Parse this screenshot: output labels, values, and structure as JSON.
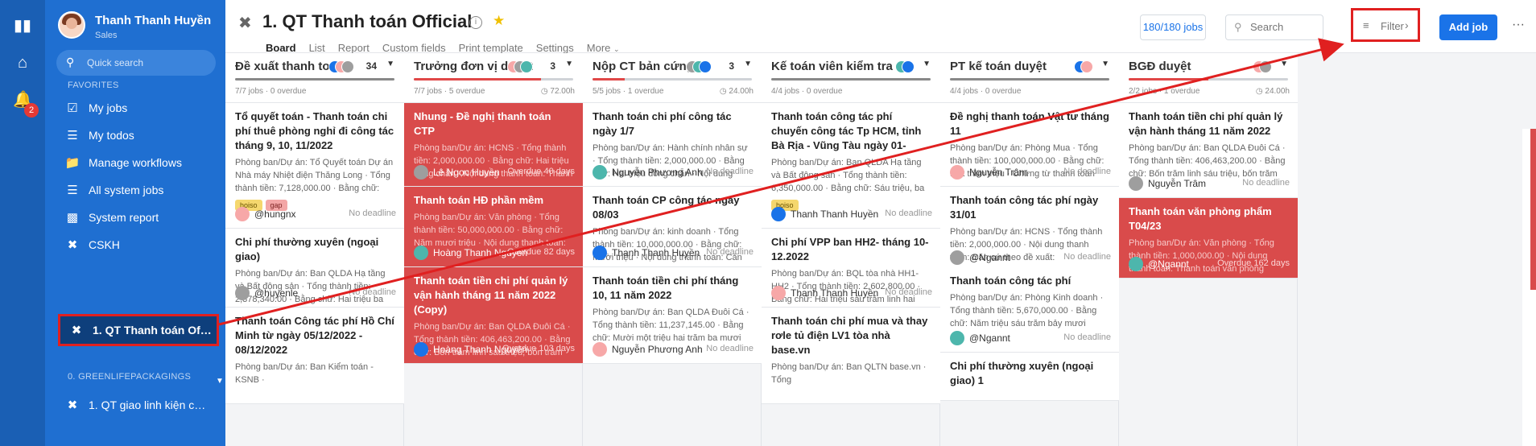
{
  "rail": {
    "notification_count": "2"
  },
  "sidebar": {
    "user_name": "Thanh Thanh Huyền",
    "user_role": "Sales",
    "quick_search_placeholder": "Quick search",
    "favorites_label": "FAVORITES",
    "items": [
      {
        "label": "My jobs",
        "icon": "check-square-icon"
      },
      {
        "label": "My todos",
        "icon": "checklist-icon"
      },
      {
        "label": "Manage workflows",
        "icon": "folder-icon"
      },
      {
        "label": "All system jobs",
        "icon": "layers-icon"
      },
      {
        "label": "System report",
        "icon": "bar-chart-icon"
      },
      {
        "label": "CSKH",
        "icon": "workflow-icon"
      },
      {
        "label": "1. QT Thanh toán Offic...",
        "icon": "workflow-icon"
      }
    ],
    "group_label": "0. GREENLIFEPACKAGINGS",
    "group_items": [
      {
        "label": "1. QT giao linh kiện ch...",
        "icon": "workflow-icon"
      }
    ]
  },
  "header": {
    "title": "1. QT Thanh toán Official",
    "tabs": [
      "Board",
      "List",
      "Report",
      "Custom fields",
      "Print template",
      "Settings",
      "More"
    ],
    "jobs_count": "180/180 jobs",
    "search_placeholder": "Search",
    "filter_label": "Filter",
    "add_job_label": "Add job",
    "more_label": "···"
  },
  "columns": [
    {
      "title": "Đề xuất thanh toán",
      "count": "34",
      "stats": "7/7 jobs · 0 overdue",
      "time": "",
      "cards": [
        {
          "title": "Tổ quyết toán - Thanh toán chi phí thuê phòng nghỉ đi công tác tháng 9, 10, 11/2022",
          "desc": "Phòng ban/Dự án: Tổ Quyết toán Dự án Nhà máy Nhiệt điện Thăng Long · Tổng thành tiền: 7,128,000.00 · Bằng chữ: Bảy triệu một...",
          "tags": [
            "hoiso",
            "gap"
          ],
          "user": "@hungnx",
          "deadline": "No deadline"
        },
        {
          "title": "Chi phí thường xuyên (ngoại giao)",
          "desc": "Phòng ban/Dự án: Ban QLDA Hạ tầng và Bất động sản · Tổng thành tiền: 2,378,340.00 · Bằng chữ: Hai triệu ba trăm bảy mươi tám...",
          "tags": [],
          "user": "@huyenle",
          "deadline": "No deadline"
        },
        {
          "title": "Thanh toán Công tác phí Hồ Chí Minh từ ngày 05/12/2022 - 08/12/2022",
          "desc": "Phòng ban/Dự án: Ban Kiểm toán - KSNB ·",
          "tags": [],
          "user": "",
          "deadline": ""
        }
      ]
    },
    {
      "title": "Trưởng đơn vị duyệt",
      "count": "3",
      "stats": "7/7 jobs · 5 overdue",
      "time": "72.00h",
      "cards": [
        {
          "title": "Nhung - Đề nghị thanh toán CTP",
          "desc": "Phòng ban/Dự án: HCNS · Tổng thành tiền: 2,000,000.00 · Bằng chữ: Hai triệu đồng chẵn · Nội dung thanh toán: Thanh toán công tá...",
          "tags": [],
          "user": "Lê Ngọc Huyền",
          "deadline": "Overdue 40 days"
        },
        {
          "title": "Thanh toán HĐ phần mềm",
          "desc": "Phòng ban/Dự án: Văn phòng · Tổng thành tiền: 50,000,000.00 · Bằng chữ: Năm mươi triệu · Nội dung thanh toán: Thanh toán...",
          "tags": [],
          "user": "Hoàng Thanh Nguyên",
          "deadline": "Overdue 82 days"
        },
        {
          "title": "Thanh toán tiền chi phí quản lý vận hành tháng 11 năm 2022 (Copy)",
          "desc": "Phòng ban/Dự án: Ban QLDA Đuôi Cá · Tổng thành tiền: 406,463,200.00 · Bằng chữ: Bốn trăm linh sáu triệu, bốn trăm sáu mươi ba...",
          "tags": [],
          "user": "Hoàng Thanh Nguyên",
          "deadline": "Overdue 103 days"
        }
      ]
    },
    {
      "title": "Nộp CT bản cứng",
      "count": "3",
      "stats": "5/5 jobs · 1 overdue",
      "time": "24.00h",
      "cards": [
        {
          "title": "Thanh toán chi phí công tác ngày 1/7",
          "desc": "Phòng ban/Dự án: Hành chính nhân sự · Tổng thành tiền: 2,000,000.00 · Bằng chữ: Hai triệu đồng chẵn · Nội dung thanh toán: CT...",
          "tags": [],
          "user": "Nguyễn Phương Anh",
          "deadline": "No deadline"
        },
        {
          "title": "Thanh toán CP công tác ngày 08/03",
          "desc": "Phòng ban/Dự án: kinh doanh · Tổng thành tiền: 10,000,000.00 · Bằng chữ: Mười triệu · Nội dung thanh toán: Căn cứ theo đề xuất đã dc duy...",
          "tags": [],
          "user": "Thanh Thanh Huyền",
          "deadline": "No deadline"
        },
        {
          "title": "Thanh toán tiền chi phí tháng 10, 11 năm 2022",
          "desc": "Phòng ban/Dự án: Ban QLDA Đuôi Cá · Tổng thành tiền: 11,237,145.00 · Bằng chữ: Mười một triệu hai trăm ba mươi bảy ngàn một...",
          "tags": [],
          "user": "Nguyễn Phương Anh",
          "deadline": "No deadline"
        }
      ]
    },
    {
      "title": "Kế toán viên kiểm tra",
      "count": "",
      "stats": "4/4 jobs · 0 overdue",
      "time": "",
      "cards": [
        {
          "title": "Thanh toán công tác phí chuyến công tác Tp HCM, tỉnh Bà Rịa - Vũng Tàu ngày 01-02/12/2022",
          "desc": "Phòng ban/Dự án: Ban QLDA Hạ tầng và Bất động sản · Tổng thành tiền: 6,350,000.00 · Bằng chữ: Sáu triệu, ba trăm năm mươi...",
          "tags": [
            "hoiso"
          ],
          "user": "Thanh Thanh Huyền",
          "deadline": "No deadline"
        },
        {
          "title": "Chi phí VPP ban HH2- tháng 10-12.2022",
          "desc": "Phòng ban/Dự án: BQL tòa nhà HH1-HH2 · Tổng thành tiền: 2,602,800.00 · Bằng chữ: Hai triệu sáu trăm linh hai nghìn tám trăm đồn...",
          "tags": [],
          "user": "Thanh Thanh Huyền",
          "deadline": "No deadline"
        },
        {
          "title": "Thanh toán chi phí mua và thay rơle tủ điện LV1 tòa nhà base.vn",
          "desc": "Phòng ban/Dự án: Ban QLTN base.vn · Tổng",
          "tags": [],
          "user": "",
          "deadline": ""
        }
      ]
    },
    {
      "title": "PT kế toán duyệt",
      "count": "",
      "stats": "4/4 jobs · 0 overdue",
      "time": "",
      "cards": [
        {
          "title": "Đề nghị thanh toán Vật tư tháng 11",
          "desc": "Phòng ban/Dự án: Phòng Mua · Tổng thành tiền: 100,000,000.00 · Bằng chữ: Một trăm triệu · Chứng từ thanh toán kèm theo gồm:...",
          "tags": [],
          "user": "Nguyễn Trâm",
          "deadline": "No deadline"
        },
        {
          "title": "Thanh toán công tác phí ngày 31/01",
          "desc": "Phòng ban/Dự án: HCNS · Tổng thành tiền: 2,000,000.00 · Nội dung thanh toán: Căn cứ theo đề xuất: https://request.base.vn/home...",
          "tags": [],
          "user": "@Ngannt",
          "deadline": "No deadline"
        },
        {
          "title": "Thanh toán công tác phí",
          "desc": "Phòng ban/Dự án: Phòng Kinh doanh · Tổng thành tiền: 5,670,000.00 · Bằng chữ: Năm triệu sáu trăm bảy mươi nghìn đồng · Nội...",
          "tags": [],
          "user": "@Ngannt",
          "deadline": "No deadline"
        },
        {
          "title": "Chi phí thường xuyên (ngoại giao) 1",
          "desc": "",
          "tags": [],
          "user": "",
          "deadline": ""
        }
      ]
    },
    {
      "title": "BGĐ duyệt",
      "count": "",
      "stats": "2/2 jobs · 1 overdue",
      "time": "24.00h",
      "cards": [
        {
          "title": "Thanh toán tiền chi phí quản lý vận hành tháng 11 năm 2022",
          "desc": "Phòng ban/Dự án: Ban QLDA Đuôi Cá · Tổng thành tiền: 406,463,200.00 · Bằng chữ: Bốn trăm linh sáu triệu, bốn trăm sáu mươi ba...",
          "tags": [],
          "user": "Nguyễn Trâm",
          "deadline": "No deadline"
        },
        {
          "title": "Thanh toán văn phòng phẩm T04/23",
          "desc": "Phòng ban/Dự án: Văn phòng · Tổng thành tiền: 1,000,000.00 · Nội dung thanh toán: Thanh toán văn phòng phẩm T04/23 · Chứ...",
          "tags": [],
          "user": "@Ngannt",
          "deadline": "Overdue 162 days"
        }
      ]
    }
  ],
  "colors": {
    "accent": "#1a73e8",
    "sidebar": "#1f6fd1",
    "overdue_card": "#d94b4b",
    "annotation": "#e02020"
  }
}
